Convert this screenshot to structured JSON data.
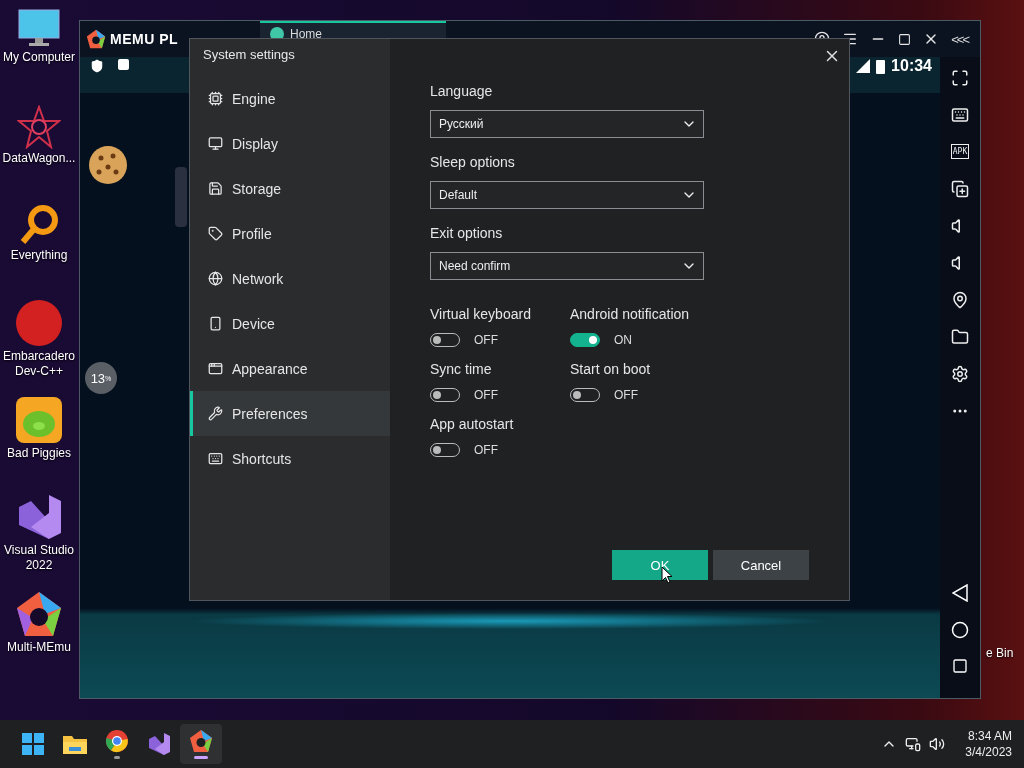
{
  "desktop": {
    "icons": [
      {
        "label": "My Computer"
      },
      {
        "label": "DataWagon..."
      },
      {
        "label": "Everything"
      },
      {
        "label": "Embarcadero Dev-C++"
      },
      {
        "label": "Bad Piggies"
      },
      {
        "label": "Visual Studio 2022"
      },
      {
        "label": "Multi-MEmu"
      }
    ],
    "recycle_label": "e Bin"
  },
  "emulator": {
    "logo": "MEMU PL",
    "tab": {
      "label": "Home",
      "selected": true
    },
    "status_time": "10:34",
    "progress_badge": "13$^{%}$",
    "collapse_glyph": "<<<",
    "apk_label": "APK"
  },
  "dialog": {
    "title": "System settings",
    "nav": [
      {
        "label": "Engine",
        "selected": false
      },
      {
        "label": "Display",
        "selected": false
      },
      {
        "label": "Storage",
        "selected": false
      },
      {
        "label": "Profile",
        "selected": false
      },
      {
        "label": "Network",
        "selected": false
      },
      {
        "label": "Device",
        "selected": false
      },
      {
        "label": "Appearance",
        "selected": false
      },
      {
        "label": "Preferences",
        "selected": true
      },
      {
        "label": "Shortcuts",
        "selected": false
      }
    ],
    "selects": [
      {
        "label": "Language",
        "value": "Русский"
      },
      {
        "label": "Sleep options",
        "value": "Default"
      },
      {
        "label": "Exit options",
        "value": "Need confirm"
      }
    ],
    "toggles": [
      {
        "label": "Virtual keyboard",
        "on": false,
        "status": "OFF"
      },
      {
        "label": "Android notification",
        "on": true,
        "status": "ON"
      },
      {
        "label": "Sync time",
        "on": false,
        "status": "OFF"
      },
      {
        "label": "Start on boot",
        "on": false,
        "status": "OFF"
      },
      {
        "label": "App autostart",
        "on": false,
        "status": "OFF"
      }
    ],
    "buttons": [
      {
        "label": "OK",
        "kind": "primary"
      },
      {
        "label": "Cancel",
        "kind": "secondary"
      }
    ]
  },
  "taskbar": {
    "apps": [
      {
        "kind": "start",
        "running": false,
        "selected": false
      },
      {
        "kind": "explorer",
        "running": false,
        "selected": false
      },
      {
        "kind": "chrome",
        "running": true,
        "selected": false
      },
      {
        "kind": "studio",
        "running": false,
        "selected": false
      },
      {
        "kind": "memu",
        "running": true,
        "selected": true
      }
    ],
    "clock": {
      "time": "8:34 AM",
      "date": "3/4/2023"
    }
  }
}
